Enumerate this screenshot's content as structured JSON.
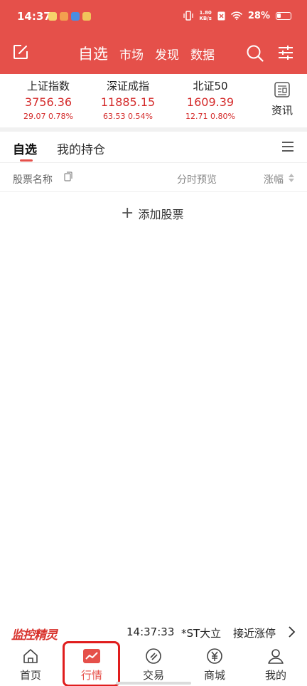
{
  "status_bar": {
    "time": "14:37",
    "net_speed_value": "1.80",
    "net_speed_unit": "KB/s",
    "battery": "28%"
  },
  "header": {
    "tabs": [
      {
        "label": "自选",
        "active": true
      },
      {
        "label": "市场",
        "active": false
      },
      {
        "label": "发现",
        "active": false
      },
      {
        "label": "数据",
        "active": false
      }
    ],
    "accent_color": "#e5504a"
  },
  "indices": [
    {
      "name": "上证指数",
      "value": "3756.36",
      "change": "29.07  0.78%"
    },
    {
      "name": "深证成指",
      "value": "11885.15",
      "change": "63.53  0.54%"
    },
    {
      "name": "北证50",
      "value": "1609.39",
      "change": "12.71  0.80%"
    }
  ],
  "news": {
    "label": "资讯"
  },
  "subtabs": [
    {
      "label": "自选",
      "active": true
    },
    {
      "label": "我的持仓",
      "active": false
    }
  ],
  "columns": {
    "name": "股票名称",
    "trend": "分时预览",
    "change": "涨幅"
  },
  "add_stock": {
    "label": "添加股票"
  },
  "ticker": {
    "logo": "监控精灵",
    "time": "14:37:33",
    "stock": "*ST大立",
    "event": "接近涨停"
  },
  "bottom_nav": [
    {
      "label": "首页",
      "icon": "home-icon",
      "active": false
    },
    {
      "label": "行情",
      "icon": "trend-chart-icon",
      "active": true
    },
    {
      "label": "交易",
      "icon": "trade-icon",
      "active": false
    },
    {
      "label": "商城",
      "icon": "yen-icon",
      "active": false
    },
    {
      "label": "我的",
      "icon": "user-icon",
      "active": false
    }
  ]
}
